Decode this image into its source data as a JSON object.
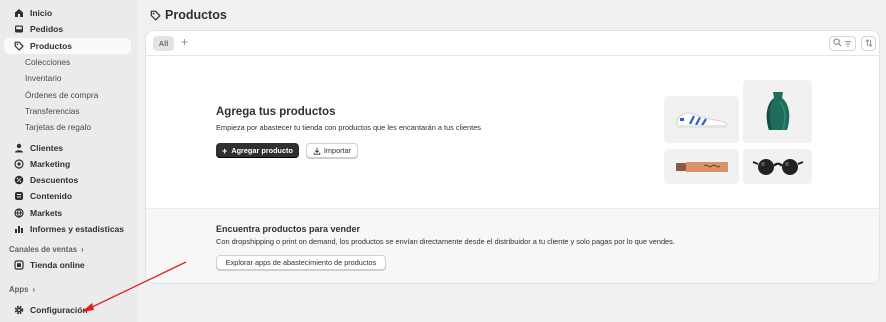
{
  "sidebar": {
    "items": [
      {
        "label": "Inicio",
        "icon": "home-icon"
      },
      {
        "label": "Pedidos",
        "icon": "inbox-icon"
      },
      {
        "label": "Productos",
        "icon": "tag-icon",
        "active": true
      }
    ],
    "product_subitems": [
      "Colecciones",
      "Inventario",
      "Órdenes de compra",
      "Transferencias",
      "Tarjetas de regalo"
    ],
    "items2": [
      {
        "label": "Clientes",
        "icon": "person-icon"
      },
      {
        "label": "Marketing",
        "icon": "target-icon"
      },
      {
        "label": "Descuentos",
        "icon": "discount-icon"
      },
      {
        "label": "Contenido",
        "icon": "content-icon"
      },
      {
        "label": "Markets",
        "icon": "globe-icon"
      },
      {
        "label": "Informes y estadísticas",
        "icon": "chart-icon"
      }
    ],
    "sales_channels_label": "Canales de ventas",
    "online_store_label": "Tienda online",
    "apps_label": "Apps",
    "settings_label": "Configuración"
  },
  "page": {
    "title": "Productos"
  },
  "toolbar": {
    "tab_all": "All",
    "add_tab": "+"
  },
  "empty_state": {
    "title": "Agrega tus productos",
    "description": "Empieza por abastecer tu tienda con productos que les encantarán a tus clientes",
    "primary_button": "Agregar producto",
    "secondary_button": "Importar"
  },
  "find_products": {
    "title": "Encuentra productos para vender",
    "description": "Con dropshipping o print on demand, los productos se envían directamente desde el distribuidor a tu cliente y solo pagas por lo que vendes.",
    "button": "Explorar apps de abastecimiento de productos"
  },
  "colors": {
    "annotation_arrow": "#e0201b",
    "primary_button": "#303030",
    "vase": "#1f6b5c",
    "shoe_stripes": "#2f5fd0"
  }
}
